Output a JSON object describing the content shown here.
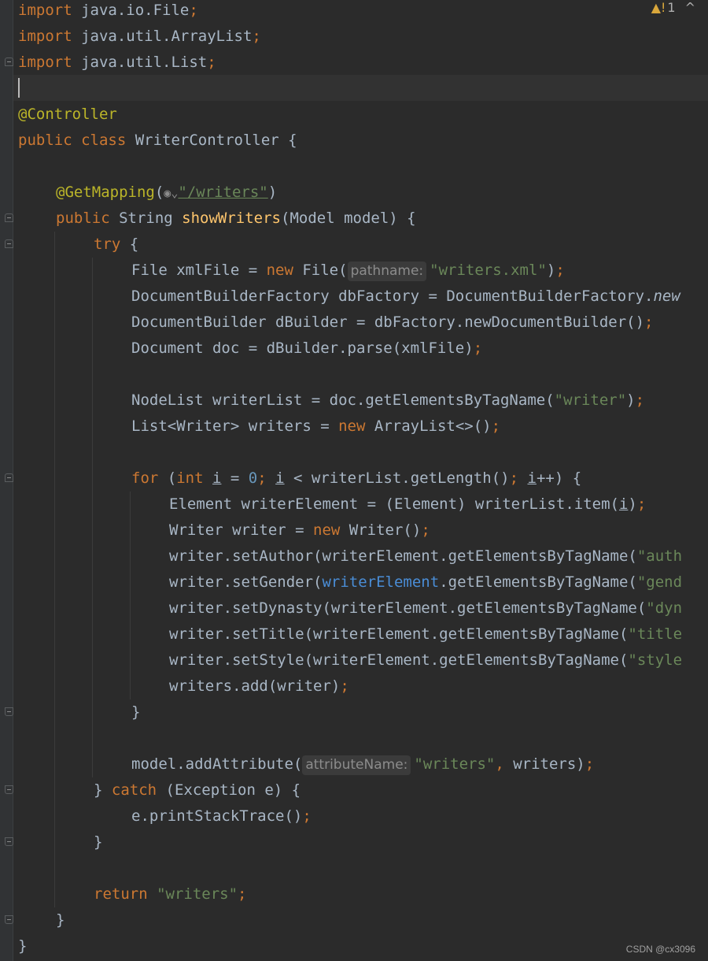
{
  "editor": {
    "lines": {
      "l1_kw": "import",
      "l1_rest": " java.io.File",
      "l1_semi": ";",
      "l2_kw": "import",
      "l2_rest": " java.util.ArrayList",
      "l2_semi": ";",
      "l3_kw": "import",
      "l3_rest": " java.util.List",
      "l3_semi": ";",
      "l5_ann": "@Controller",
      "l6_kw": "public class",
      "l6_rest": " WriterController {",
      "l8_ann": "@GetMapping",
      "l8_p1": "(",
      "l8_str": "\"/writers\"",
      "l8_p2": ")",
      "l9_kw": "public",
      "l9_t": " String ",
      "l9_m": "showWriters",
      "l9_rest": "(Model model) {",
      "l10_kw": "try",
      "l10_rest": " {",
      "l11_a": "File xmlFile = ",
      "l11_kw": "new",
      "l11_b": " File(",
      "l11_hint": "pathname:",
      "l11_str": "\"writers.xml\"",
      "l11_c": ")",
      "l11_semi": ";",
      "l12_a": "DocumentBuilderFactory dbFactory = DocumentBuilderFactory.",
      "l12_i": "new",
      "l13_a": "DocumentBuilder dBuilder = dbFactory.newDocumentBuilder()",
      "l13_semi": ";",
      "l14_a": "Document doc = dBuilder.parse(xmlFile)",
      "l14_semi": ";",
      "l16_a": "NodeList writerList = doc.getElementsByTagName(",
      "l16_str": "\"writer\"",
      "l16_b": ")",
      "l16_semi": ";",
      "l17_a": "List<Writer> writers = ",
      "l17_kw": "new",
      "l17_b": " ArrayList<>()",
      "l17_semi": ";",
      "l19_kw": "for",
      "l19_a": " (",
      "l19_kw2": "int",
      "l19_b": " ",
      "l19_i1": "i",
      "l19_c": " = ",
      "l19_n": "0",
      "l19_semi1": ";",
      "l19_d": " ",
      "l19_i2": "i",
      "l19_e": " < writerList.getLength()",
      "l19_semi2": ";",
      "l19_f": " ",
      "l19_i3": "i",
      "l19_g": "++) {",
      "l20_a": "Element writerElement = (Element) writerList.item(",
      "l20_i": "i",
      "l20_b": ")",
      "l20_semi": ";",
      "l21_a": "Writer writer = ",
      "l21_kw": "new",
      "l21_b": " Writer()",
      "l21_semi": ";",
      "l22_a": "writer.setAuthor(writerElement.getElementsByTagName(",
      "l22_str": "\"auth",
      "l23_a": "writer.setGender(",
      "l23_v": "writerElement",
      "l23_b": ".getElementsByTagName(",
      "l23_str": "\"gend",
      "l24_a": "writer.setDynasty(writerElement.getElementsByTagName(",
      "l24_str": "\"dyn",
      "l25_a": "writer.setTitle(writerElement.getElementsByTagName(",
      "l25_str": "\"title",
      "l26_a": "writer.setStyle(writerElement.getElementsByTagName(",
      "l26_str": "\"style",
      "l27_a": "writers.add(writer)",
      "l27_semi": ";",
      "l28_a": "}",
      "l30_a": "model.addAttribute(",
      "l30_hint": "attributeName:",
      "l30_str": "\"writers\"",
      "l30_comma": ",",
      "l30_b": " writers)",
      "l30_semi": ";",
      "l31_a": "} ",
      "l31_kw": "catch",
      "l31_b": " (Exception e) {",
      "l32_a": "e.printStackTrace()",
      "l32_semi": ";",
      "l33_a": "}",
      "l35_kw": "return",
      "l35_sp": " ",
      "l35_str": "\"writers\"",
      "l35_semi": ";",
      "l36_a": "}",
      "l37_a": "}"
    }
  },
  "status": {
    "warning_icon": "warning-triangle-icon",
    "warning_glyph": "▲!",
    "warning_count": "1",
    "nav_up_icon": "chevron-up-icon",
    "nav_up_glyph": "^"
  },
  "watermark": "CSDN @cx3096",
  "colors": {
    "background": "#2b2b2b",
    "keyword": "#cc7832",
    "string": "#6a8759",
    "annotation": "#bbb529",
    "method": "#ffc66d",
    "number": "#6897bb",
    "text": "#a9b7c6"
  }
}
